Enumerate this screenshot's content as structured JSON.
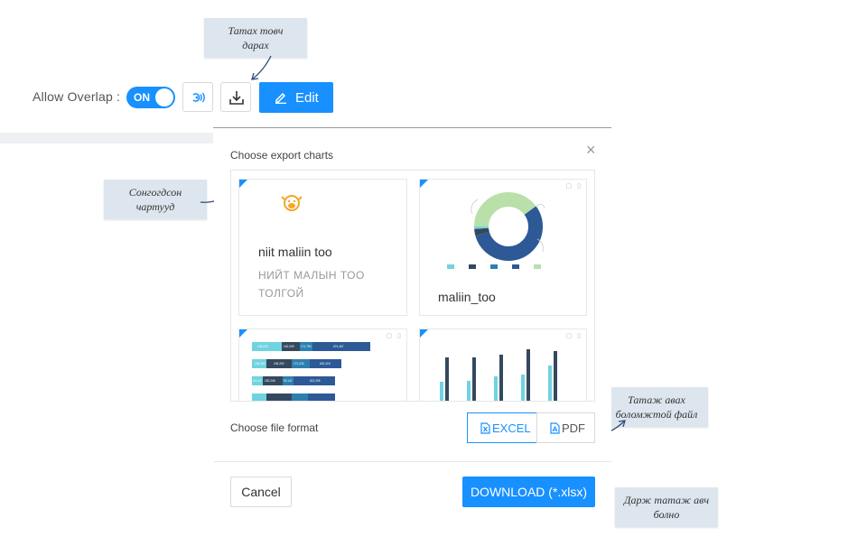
{
  "toolbar": {
    "allow_overlap_label": "Allow Overlap :",
    "toggle_label": "ON",
    "edit_label": "Edit"
  },
  "annotations": {
    "download_hint": [
      "Татах товч",
      "дарах"
    ],
    "selected_charts_hint": [
      "Сонгогдсон",
      "чартууд"
    ],
    "formats_hint": [
      "Татаж авах",
      "боломжтой файл"
    ],
    "press_download_hint": [
      "Дарж татаж авч",
      "болно"
    ]
  },
  "modal": {
    "title": "Choose export charts",
    "close": "×",
    "charts": [
      {
        "title": "niit maliin too",
        "subtitle_lines": [
          "НИЙТ МАЛЫН ТОО",
          "ТОЛГОЙ"
        ]
      },
      {
        "title": "maliin_too"
      }
    ],
    "format_label": "Choose file format",
    "formats": [
      "EXCEL",
      "PDF"
    ],
    "cancel_label": "Cancel",
    "download_label": "DOWNLOAD (*.xlsx)"
  },
  "mini_bar_chart": {
    "rows": [
      [
        "106,878",
        "152,009",
        "171,753",
        "674,467"
      ],
      [
        "106,260",
        "106,202",
        "171,233",
        "602,315"
      ],
      [
        "111,10",
        "152,246",
        "90,147",
        "612,205"
      ],
      [
        "",
        "",
        "",
        ""
      ]
    ]
  },
  "colors": {
    "accent": "#1890ff",
    "teal": "#6fd4e0",
    "dark_slate": "#34495e",
    "navy": "#2d5996",
    "light_green": "#b8e0a8"
  }
}
